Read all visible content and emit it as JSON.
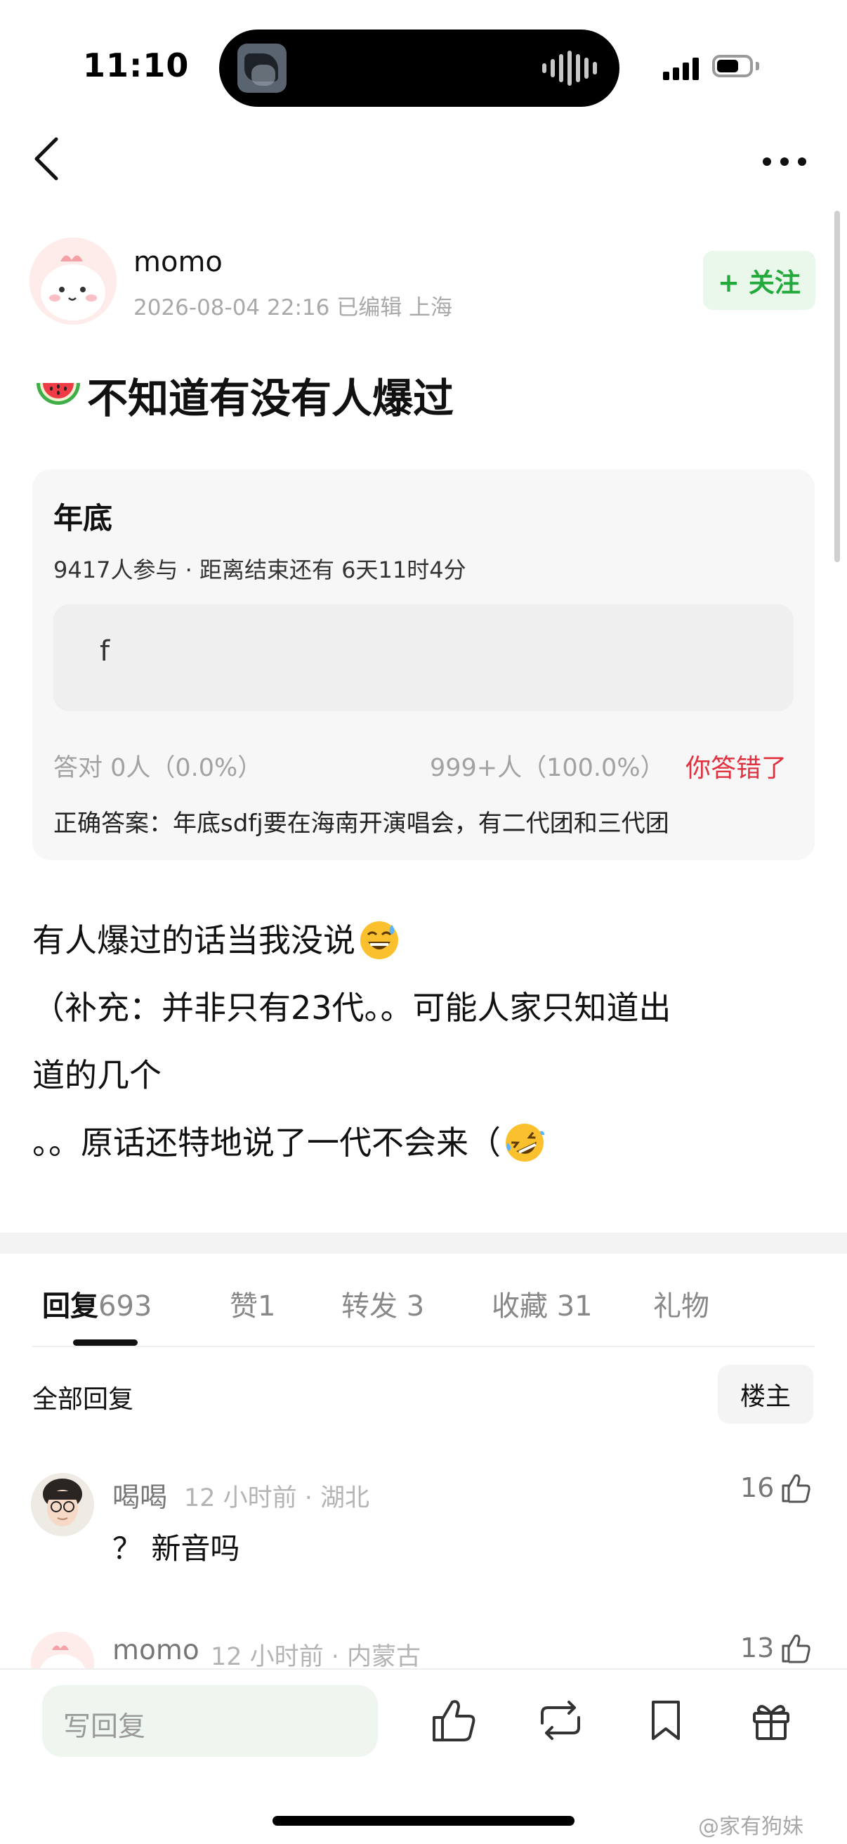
{
  "status_bar": {
    "time": "11:10"
  },
  "post": {
    "author": {
      "name": "momo",
      "meta": "2026-08-04 22:16  已编辑  上海"
    },
    "follow_label": "+ 关注",
    "title": "不知道有没有人爆过",
    "quiz": {
      "title": "年底",
      "meta": "9417人参与 · 距离结束还有 6天11时4分",
      "option": "f",
      "correct_stat": "答对  0人（0.0%）",
      "wrong_stat": "999+人（100.0%）",
      "status": "你答错了",
      "answer": "正确答案：年底sdfj要在海南开演唱会，有二代团和三代团"
    },
    "body_lines": [
      "有人爆过的话当我没说",
      "（补充：并非只有23代。。可能人家只知道出",
      "道的几个",
      "。。原话还特地说了一代不会来（"
    ]
  },
  "tabs": [
    {
      "label": "回复",
      "count": "693",
      "active": true
    },
    {
      "label": "赞",
      "count": "1",
      "active": false
    },
    {
      "label": "转发",
      "count": "3",
      "active": false
    },
    {
      "label": "收藏",
      "count": "31",
      "active": false
    },
    {
      "label": "礼物",
      "count": "",
      "active": false
    }
  ],
  "replies_header": {
    "all_label": "全部回复",
    "owner_label": "楼主"
  },
  "comments": [
    {
      "name": "喝喝",
      "meta": "12 小时前 · 湖北",
      "likes": "16",
      "text": "？ 新音吗"
    },
    {
      "name": "momo",
      "meta": "12 小时前 · 内蒙古",
      "likes": "13",
      "text": ""
    }
  ],
  "bottom_bar": {
    "reply_placeholder": "写回复"
  },
  "watermark": "@家有狗妹"
}
